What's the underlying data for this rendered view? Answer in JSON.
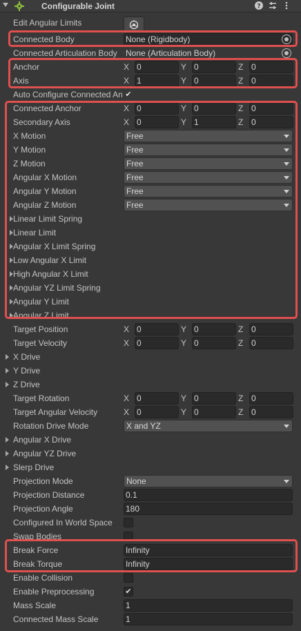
{
  "component": {
    "title": "Configurable Joint",
    "icons": {
      "help": "help-icon",
      "presets": "presets-icon",
      "menu": "kebab-menu-icon"
    }
  },
  "rows": {
    "edit_limits": {
      "label": "Edit Angular Limits"
    },
    "connected_body": {
      "label": "Connected Body",
      "value": "None (Rigidbody)"
    },
    "connected_articulation": {
      "label": "Connected Articulation Body",
      "value": "None (Articulation Body)"
    },
    "anchor": {
      "label": "Anchor",
      "x": "0",
      "y": "0",
      "z": "0"
    },
    "axis": {
      "label": "Axis",
      "x": "1",
      "y": "0",
      "z": "0"
    },
    "auto_configure": {
      "label": "Auto Configure Connected Anchor",
      "checked": true
    },
    "connected_anchor": {
      "label": "Connected Anchor",
      "x": "0",
      "y": "0",
      "z": "0"
    },
    "secondary_axis": {
      "label": "Secondary Axis",
      "x": "0",
      "y": "1",
      "z": "0"
    },
    "x_motion": {
      "label": "X Motion",
      "value": "Free"
    },
    "y_motion": {
      "label": "Y Motion",
      "value": "Free"
    },
    "z_motion": {
      "label": "Z Motion",
      "value": "Free"
    },
    "ang_x_motion": {
      "label": "Angular X Motion",
      "value": "Free"
    },
    "ang_y_motion": {
      "label": "Angular Y Motion",
      "value": "Free"
    },
    "ang_z_motion": {
      "label": "Angular Z Motion",
      "value": "Free"
    },
    "linear_limit_spring": {
      "label": "Linear Limit Spring"
    },
    "linear_limit": {
      "label": "Linear Limit"
    },
    "ang_x_limit_spring": {
      "label": "Angular X Limit Spring"
    },
    "low_ang_x_limit": {
      "label": "Low Angular X Limit"
    },
    "high_ang_x_limit": {
      "label": "High Angular X Limit"
    },
    "ang_yz_limit_spring": {
      "label": "Angular YZ Limit Spring"
    },
    "ang_y_limit": {
      "label": "Angular Y Limit"
    },
    "ang_z_limit": {
      "label": "Angular Z Limit"
    },
    "target_position": {
      "label": "Target Position",
      "x": "0",
      "y": "0",
      "z": "0"
    },
    "target_velocity": {
      "label": "Target Velocity",
      "x": "0",
      "y": "0",
      "z": "0"
    },
    "x_drive": {
      "label": "X Drive"
    },
    "y_drive": {
      "label": "Y Drive"
    },
    "z_drive": {
      "label": "Z Drive"
    },
    "target_rotation": {
      "label": "Target Rotation",
      "x": "0",
      "y": "0",
      "z": "0"
    },
    "target_ang_velocity": {
      "label": "Target Angular Velocity",
      "x": "0",
      "y": "0",
      "z": "0"
    },
    "rotation_drive_mode": {
      "label": "Rotation Drive Mode",
      "value": "X and YZ"
    },
    "ang_x_drive": {
      "label": "Angular X Drive"
    },
    "ang_yz_drive": {
      "label": "Angular YZ Drive"
    },
    "slerp_drive": {
      "label": "Slerp Drive"
    },
    "projection_mode": {
      "label": "Projection Mode",
      "value": "None"
    },
    "projection_distance": {
      "label": "Projection Distance",
      "value": "0.1"
    },
    "projection_angle": {
      "label": "Projection Angle",
      "value": "180"
    },
    "configured_world_space": {
      "label": "Configured In World Space",
      "checked": false
    },
    "swap_bodies": {
      "label": "Swap Bodies",
      "checked": false
    },
    "break_force": {
      "label": "Break Force",
      "value": "Infinity"
    },
    "break_torque": {
      "label": "Break Torque",
      "value": "Infinity"
    },
    "enable_collision": {
      "label": "Enable Collision",
      "checked": false
    },
    "enable_preprocessing": {
      "label": "Enable Preprocessing",
      "checked": true
    },
    "mass_scale": {
      "label": "Mass Scale",
      "value": "1"
    },
    "connected_mass_scale": {
      "label": "Connected Mass Scale",
      "value": "1"
    }
  },
  "axis_letters": {
    "x": "X",
    "y": "Y",
    "z": "Z"
  },
  "check_glyph": "✔",
  "colors": {
    "highlight": "#e0504f",
    "background": "#383838",
    "field": "#2a2a2a",
    "dropdown": "#515151"
  }
}
